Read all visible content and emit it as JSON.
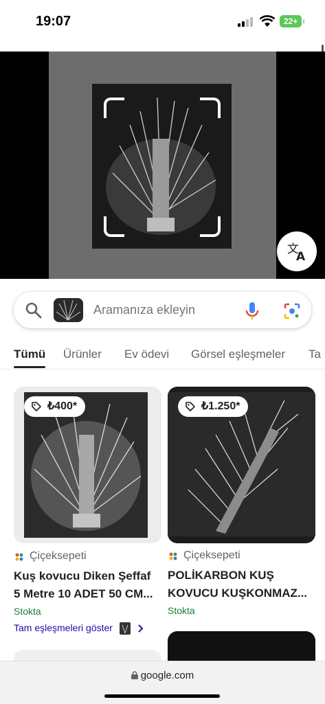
{
  "status_bar": {
    "time": "19:07",
    "battery": "22+"
  },
  "search": {
    "placeholder": "Aramanıza ekleyin"
  },
  "tabs": [
    {
      "label": "Tümü",
      "active": true
    },
    {
      "label": "Ürünler"
    },
    {
      "label": "Ev ödevi"
    },
    {
      "label": "Görsel eşleşmeler"
    },
    {
      "label": "Ta"
    }
  ],
  "results": [
    {
      "price": "₺400*",
      "merchant": "Çiçeksepeti",
      "title_line1": "Kuş kovucu Diken Şeffaf",
      "title_line2": "5 Metre 10 ADET 50 CM...",
      "stock": "Stokta",
      "more_link": "Tam eşleşmeleri göster"
    },
    {
      "price": "₺1.250*",
      "merchant": "Çiçeksepeti",
      "title_line1": "POLİKARBON KUŞ",
      "title_line2": "KOVUCU KUŞKONMAZ...",
      "stock": "Stokta"
    }
  ],
  "browser": {
    "url": "google.com"
  },
  "icons": [
    "search-icon",
    "mic-icon",
    "lens-icon",
    "translate-icon",
    "tag-icon",
    "lock-icon",
    "chevron-right-icon"
  ]
}
